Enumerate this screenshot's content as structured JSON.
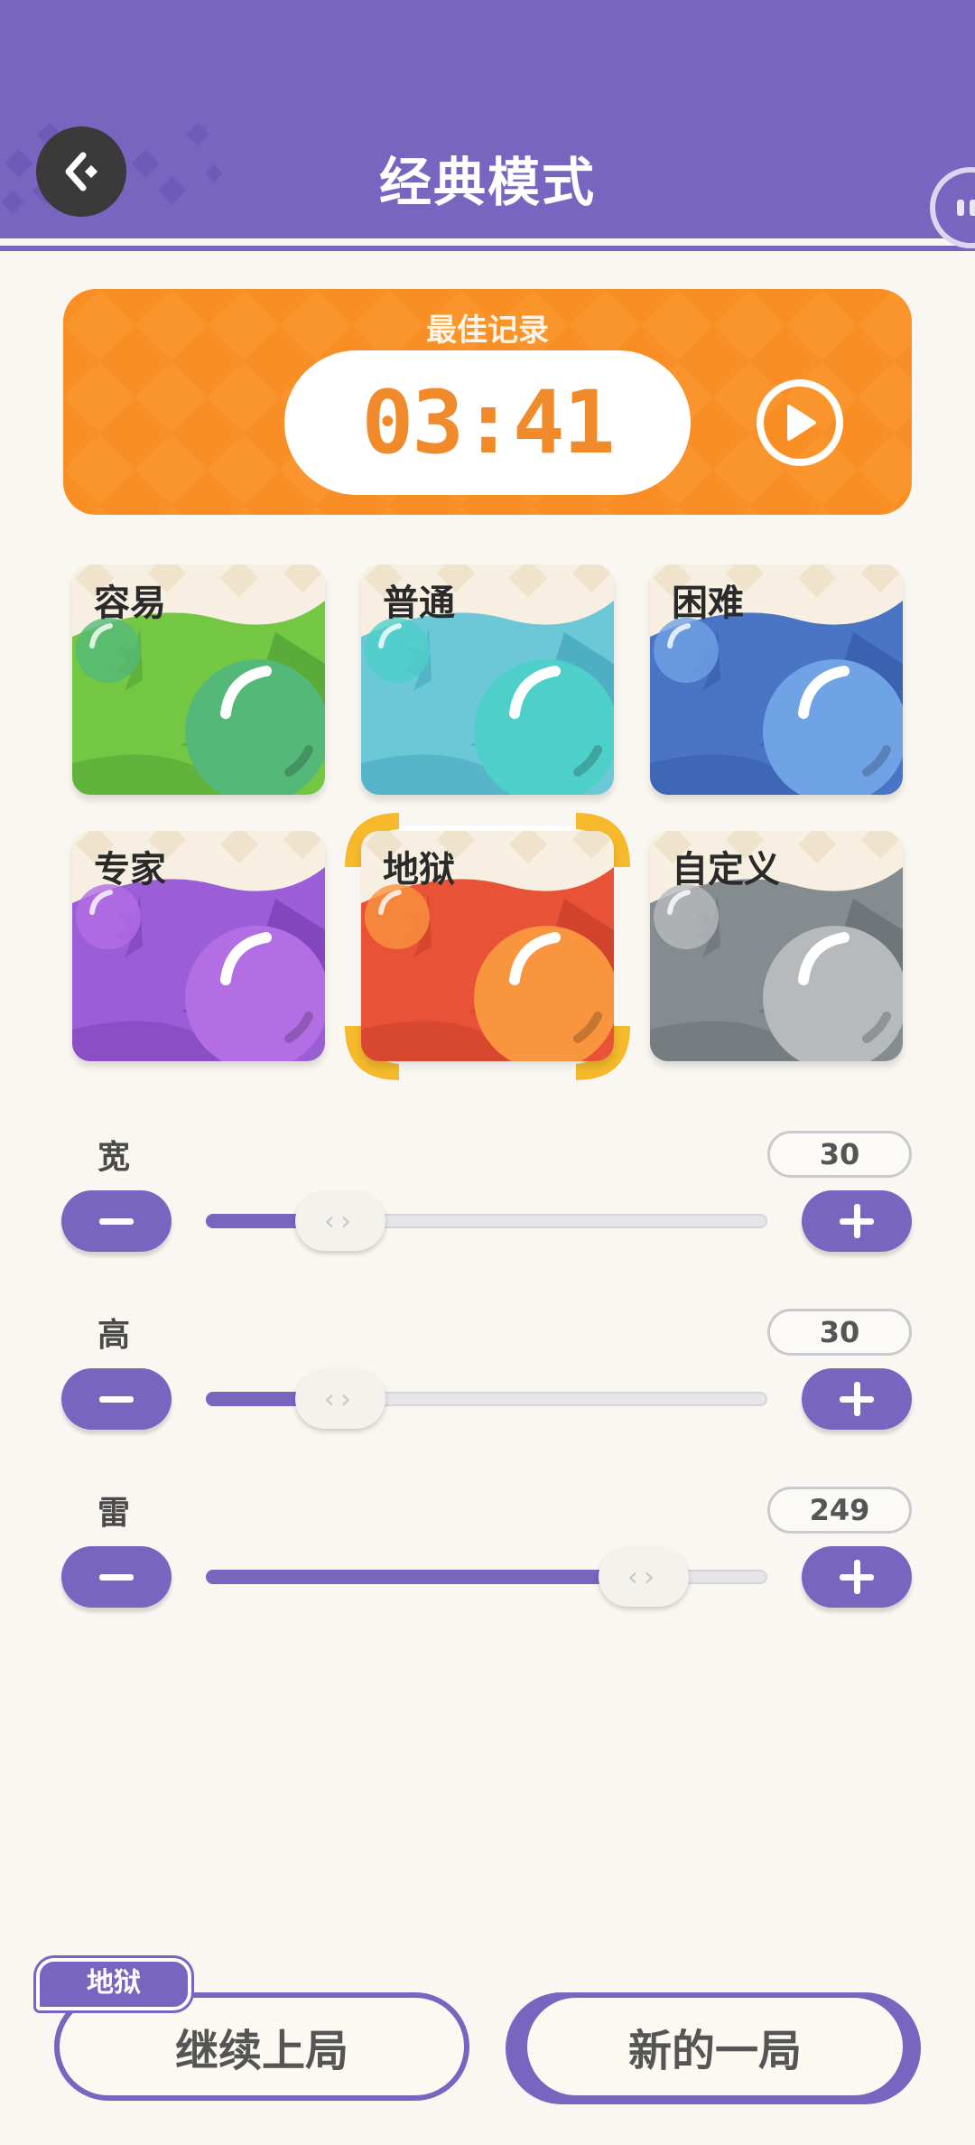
{
  "header": {
    "title": "经典模式",
    "back_icon": "back-arrow-icon",
    "pause_icon": "pause-icon",
    "color": "#7765c0"
  },
  "record": {
    "label": "最佳记录",
    "time": "03:41",
    "replay_icon": "play-icon",
    "color": "#f98e25"
  },
  "difficulties": [
    {
      "label": "容易",
      "colors": [
        "#74c743",
        "#5aab39",
        "#54b978"
      ]
    },
    {
      "label": "普通",
      "colors": [
        "#6cc7d7",
        "#4eaec3",
        "#4fcfc9"
      ]
    },
    {
      "label": "困难",
      "colors": [
        "#4a74c4",
        "#3b62b0",
        "#6fa3e6"
      ]
    },
    {
      "label": "专家",
      "colors": [
        "#9c5ed6",
        "#8347bd",
        "#b36ee4"
      ]
    },
    {
      "label": "地狱",
      "colors": [
        "#e85236",
        "#d1432c",
        "#f9943f"
      ],
      "selected": true
    },
    {
      "label": "自定义",
      "colors": [
        "#858c90",
        "#6f767a",
        "#b6babd"
      ]
    }
  ],
  "sliders": [
    {
      "label": "宽",
      "value": "30",
      "fraction": 0.24
    },
    {
      "label": "高",
      "value": "30",
      "fraction": 0.24
    },
    {
      "label": "雷",
      "value": "249",
      "fraction": 0.78
    }
  ],
  "bottom": {
    "tag": "地狱",
    "continue_label": "继续上局",
    "new_label": "新的一局"
  }
}
